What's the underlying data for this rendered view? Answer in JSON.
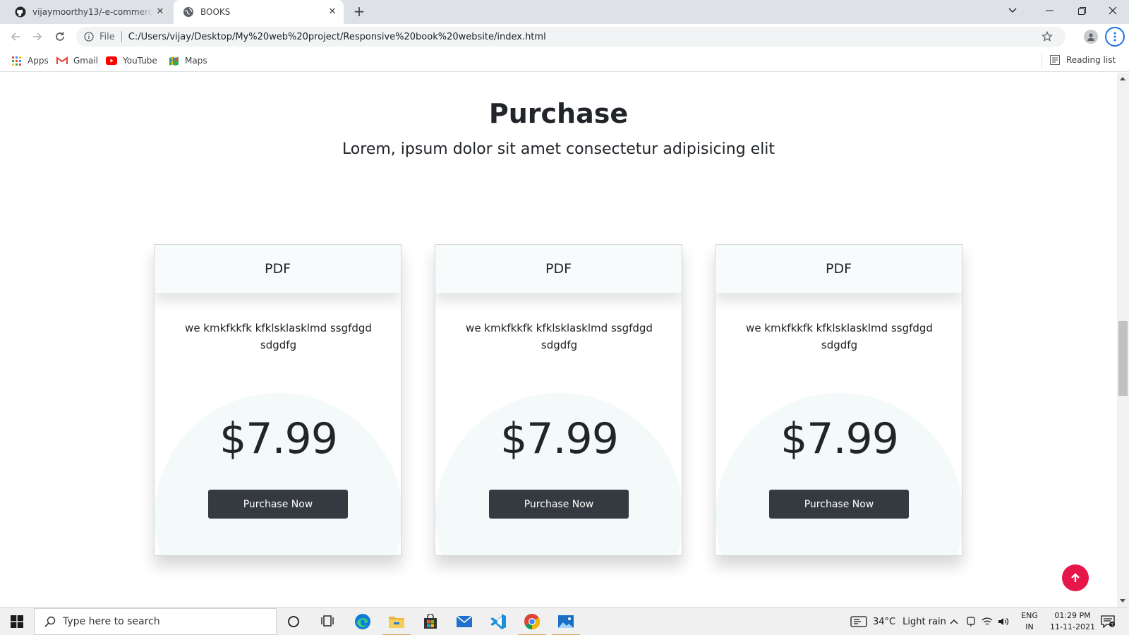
{
  "browser": {
    "tabs": [
      {
        "title": "vijaymoorthy13/-e-commerce-site",
        "icon": "github-icon",
        "active": false
      },
      {
        "title": "BOOKS",
        "icon": "globe-icon",
        "active": true
      }
    ],
    "address": {
      "scheme": "File",
      "url": "C:/Users/vijay/Desktop/My%20web%20project/Responsive%20book%20website/index.html"
    },
    "bookmarks": [
      {
        "label": "Apps",
        "icon": "apps-grid-icon"
      },
      {
        "label": "Gmail",
        "icon": "gmail-icon"
      },
      {
        "label": "YouTube",
        "icon": "youtube-icon"
      },
      {
        "label": "Maps",
        "icon": "maps-icon"
      }
    ],
    "reading_list": "Reading list"
  },
  "page": {
    "section": {
      "title": "Purchase",
      "subtitle": "Lorem, ipsum dolor sit amet consectetur adipisicing elit"
    },
    "cards": [
      {
        "format": "PDF",
        "description": "we kmkfkkfk kfklsklasklmd ssgfdgd sdgdfg",
        "price": "$7.99",
        "button": "Purchase Now"
      },
      {
        "format": "PDF",
        "description": "we kmkfkkfk kfklsklasklmd ssgfdgd sdgdfg",
        "price": "$7.99",
        "button": "Purchase Now"
      },
      {
        "format": "PDF",
        "description": "we kmkfkkfk kfklsklasklmd ssgfdgd sdgdfg",
        "price": "$7.99",
        "button": "Purchase Now"
      }
    ],
    "scroll_top_icon": "arrow-up-icon",
    "accent_color": "#e6164a",
    "button_color": "#343a40"
  },
  "taskbar": {
    "search_placeholder": "Type here to search",
    "pinned": [
      "cortana-icon",
      "task-view-icon",
      "edge-icon",
      "file-explorer-icon",
      "store-icon",
      "mail-icon",
      "vscode-icon",
      "chrome-icon",
      "photos-icon"
    ],
    "weather": {
      "temp": "34°C",
      "condition": "Light rain"
    },
    "language": {
      "lang": "ENG",
      "region": "IN"
    },
    "clock": {
      "time": "01:29 PM",
      "date": "11-11-2021"
    }
  }
}
